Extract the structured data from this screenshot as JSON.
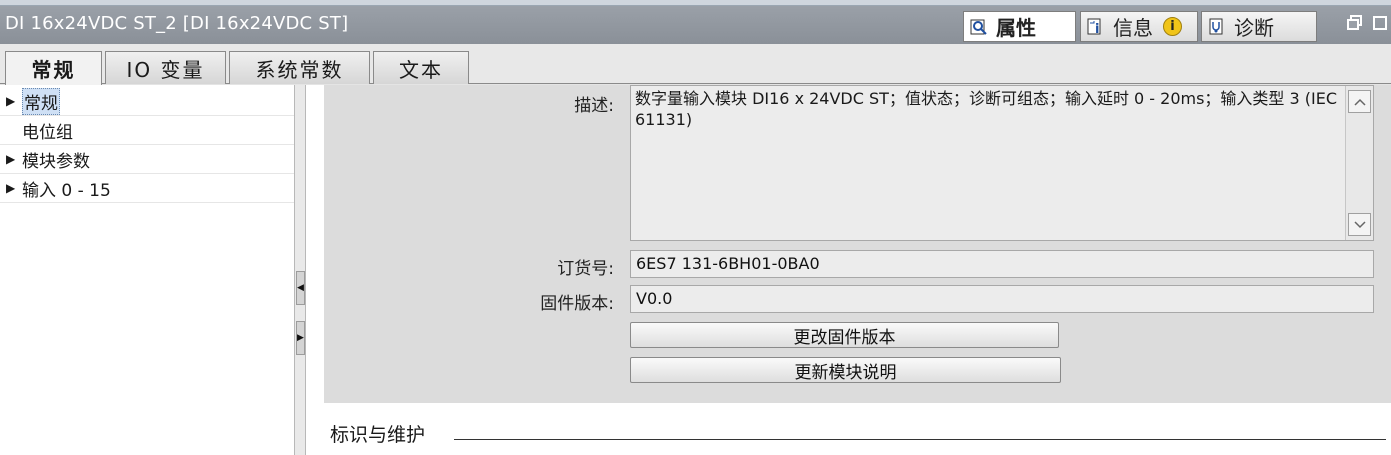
{
  "window": {
    "title": "DI 16x24VDC ST_2 [DI 16x24VDC ST]"
  },
  "inspector_tabs": [
    {
      "label": "属性",
      "icon": "properties-icon",
      "active": true
    },
    {
      "label": "信息",
      "icon": "info-icon",
      "active": false
    },
    {
      "label": "诊断",
      "icon": "diagnostics-icon",
      "active": false
    }
  ],
  "info_badge": "i",
  "tabs": [
    {
      "label": "常规",
      "active": true
    },
    {
      "label": "IO 变量",
      "active": false
    },
    {
      "label": "系统常数",
      "active": false
    },
    {
      "label": "文本",
      "active": false
    }
  ],
  "nav": [
    {
      "label": "常规",
      "expandable": true,
      "selected": true
    },
    {
      "label": "电位组",
      "expandable": false,
      "selected": false
    },
    {
      "label": "模块参数",
      "expandable": true,
      "selected": false
    },
    {
      "label": "输入 0 - 15",
      "expandable": true,
      "selected": false
    }
  ],
  "general": {
    "description_label": "描述:",
    "description_value": "数字量输入模块 DI16 x 24VDC ST；值状态；诊断可组态；输入延时 0 - 20ms；输入类型 3 (IEC 61131)",
    "order_label": "订货号:",
    "order_value": "6ES7 131-6BH01-0BA0",
    "firmware_label": "固件版本:",
    "firmware_value": "V0.0",
    "change_firmware_button": "更改固件版本",
    "update_module_button": "更新模块说明"
  },
  "section_title": "标识与维护",
  "colors": {
    "titlebar": "#8f959d",
    "panel": "#dcdcdc",
    "selection": "#cfe0f5"
  }
}
